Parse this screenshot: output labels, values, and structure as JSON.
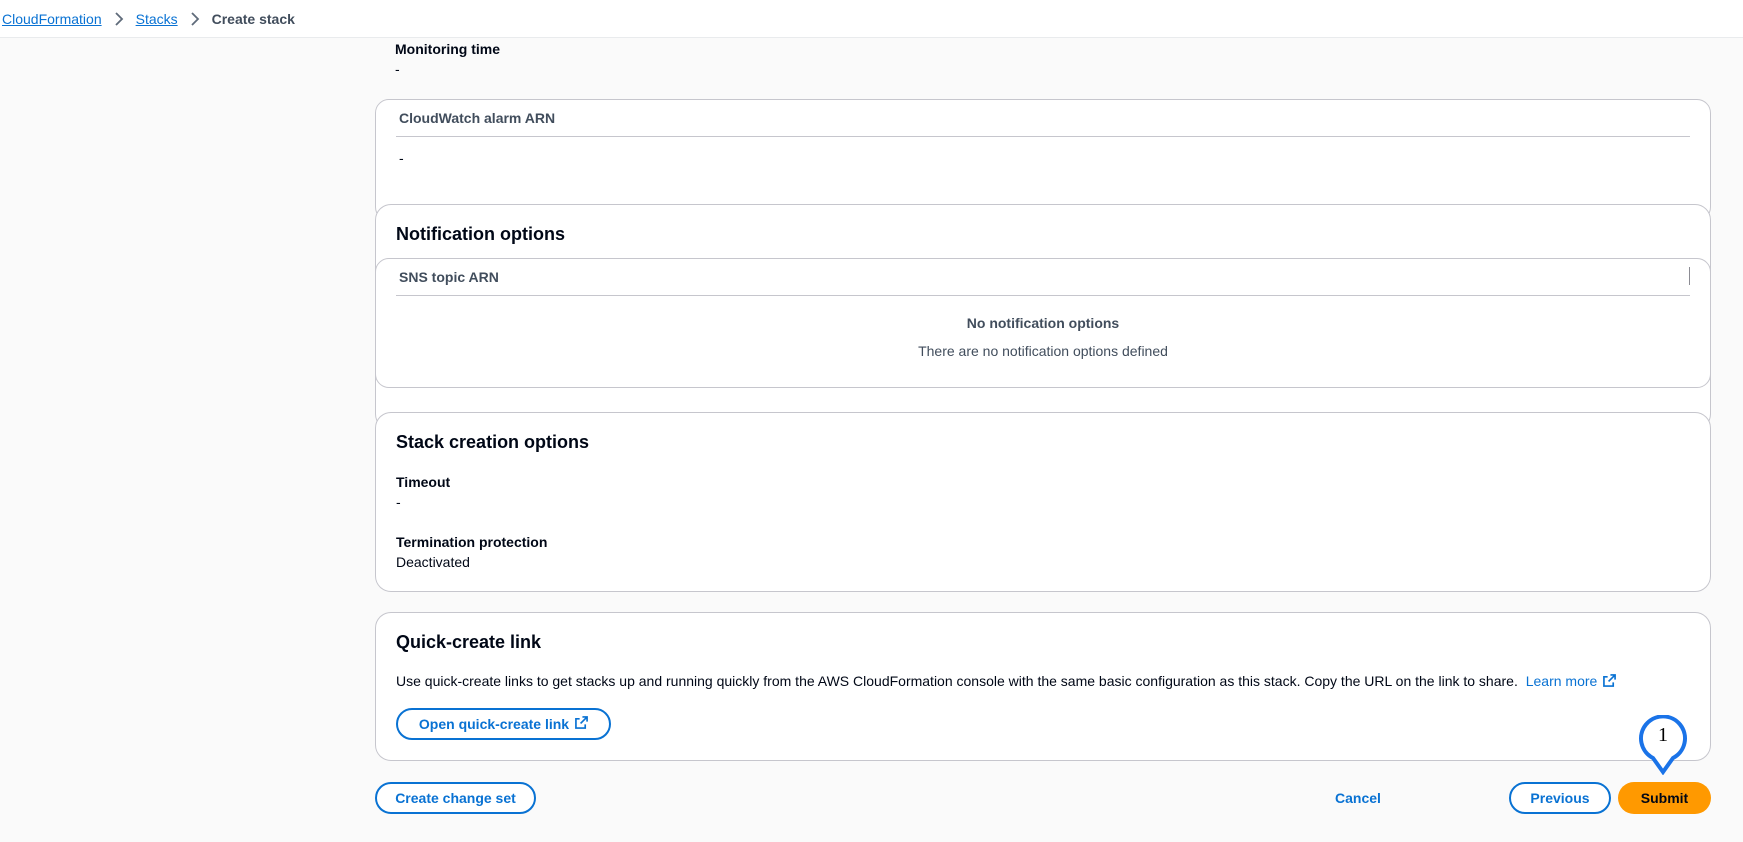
{
  "breadcrumb": {
    "items": [
      "CloudFormation",
      "Stacks"
    ],
    "current": "Create stack"
  },
  "monitoring": {
    "time_label": "Monitoring time",
    "time_value": "-",
    "alarm_header": "CloudWatch alarm ARN",
    "alarm_value": "-"
  },
  "notification": {
    "title": "Notification options",
    "column_header": "SNS topic ARN",
    "empty_title": "No notification options",
    "empty_text": "There are no notification options defined"
  },
  "stack_creation": {
    "title": "Stack creation options",
    "timeout_label": "Timeout",
    "timeout_value": "-",
    "termination_label": "Termination protection",
    "termination_value": "Deactivated"
  },
  "quick_create": {
    "title": "Quick-create link",
    "description": "Use quick-create links to get stacks up and running quickly from the AWS CloudFormation console with the same basic configuration as this stack. Copy the URL on the link to share.",
    "learn_more": "Learn more",
    "open_button": "Open quick-create link"
  },
  "footer": {
    "create_change_set": "Create change set",
    "cancel": "Cancel",
    "previous": "Previous",
    "submit": "Submit"
  },
  "annotation": {
    "marker_number": "1"
  },
  "colors": {
    "link": "#0972d3",
    "primary": "#ff9900",
    "marker": "#1a73e8"
  },
  "icons": [
    "chevron-right-icon",
    "external-link-icon"
  ]
}
